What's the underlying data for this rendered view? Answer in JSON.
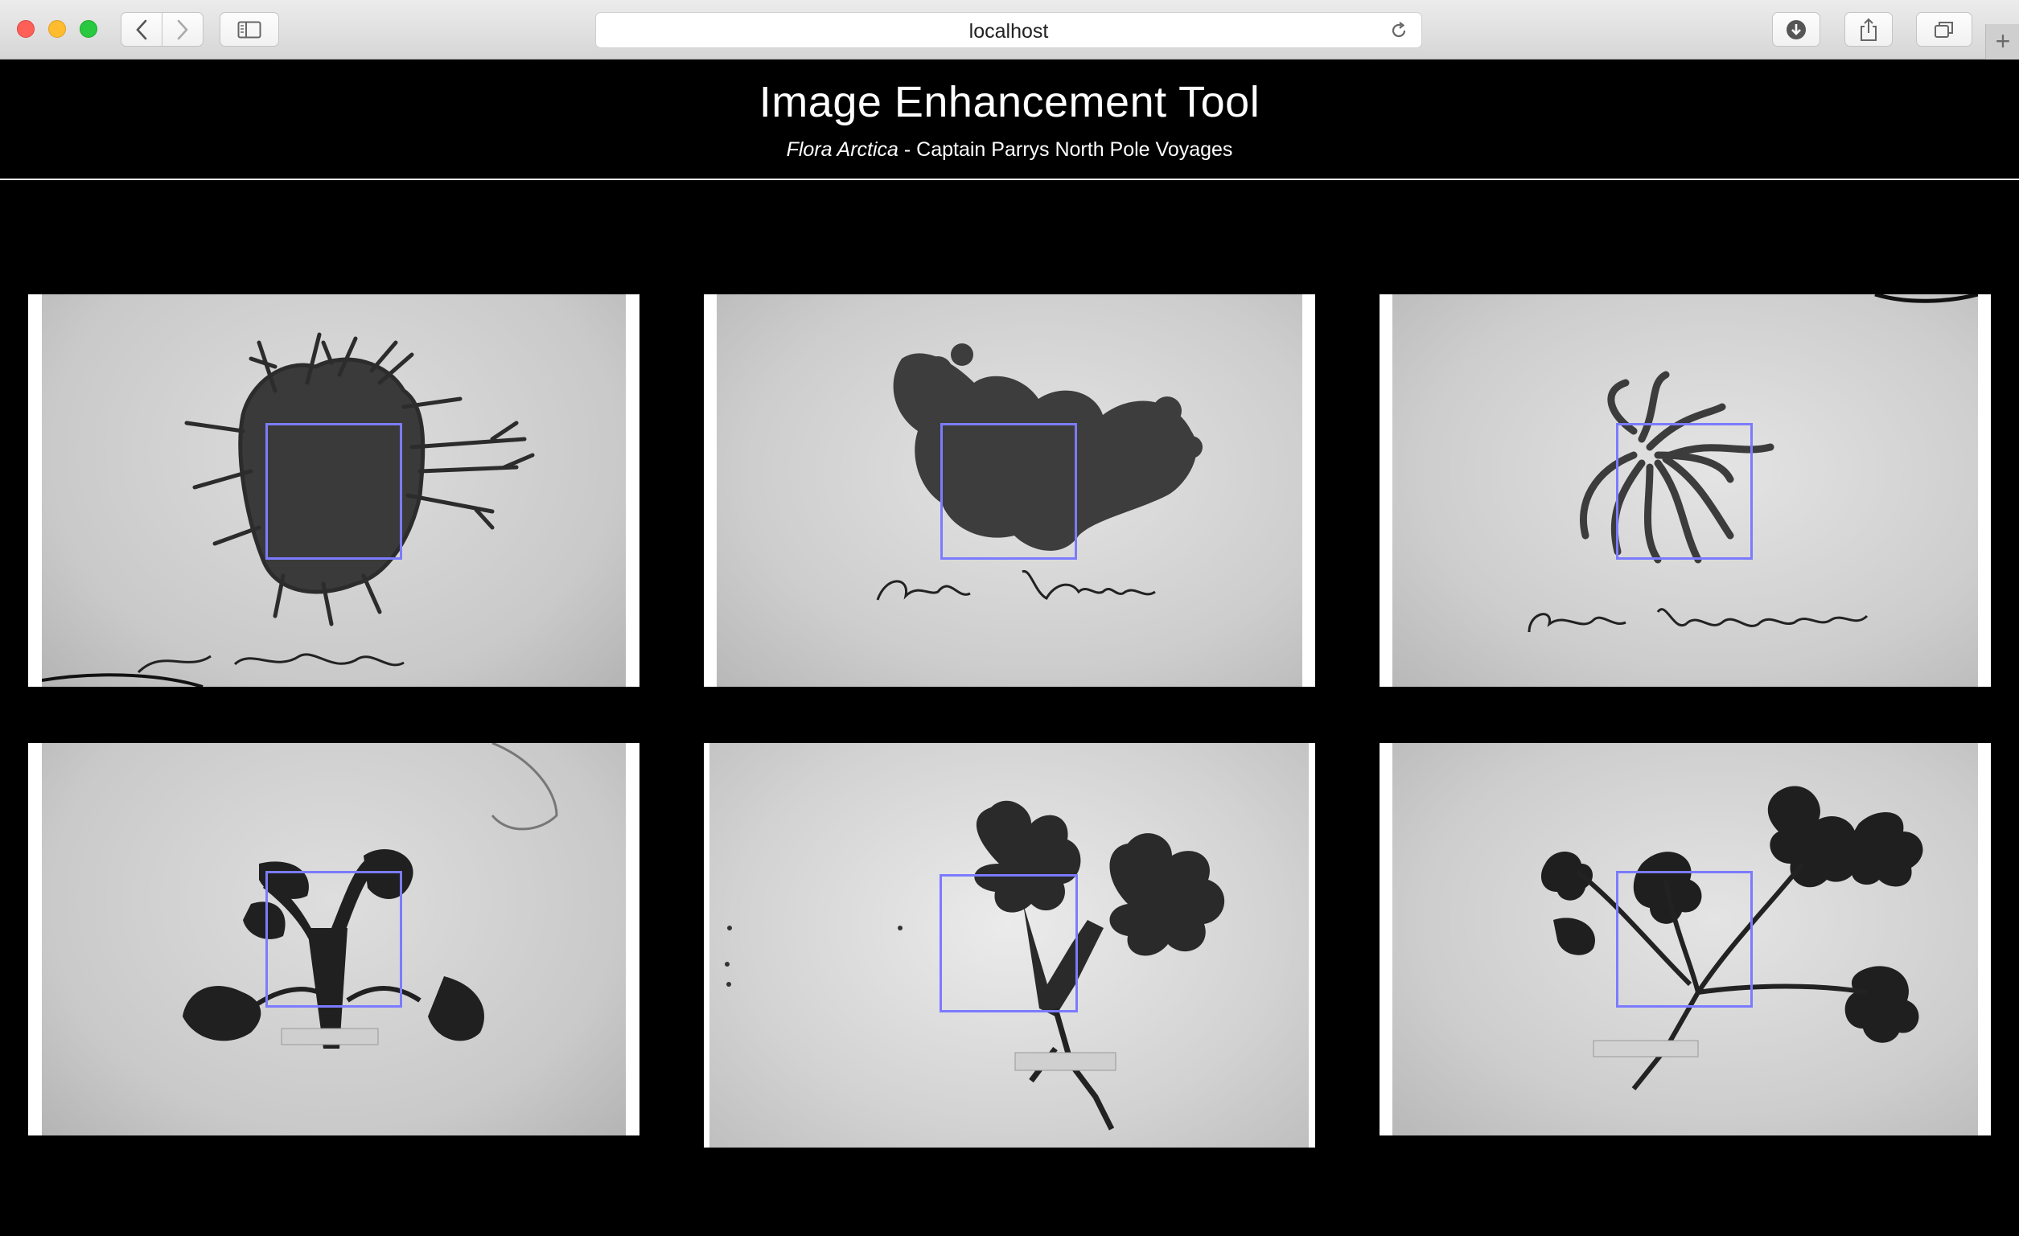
{
  "browser": {
    "address": "localhost",
    "icons": {
      "back": "chevron-left-icon",
      "forward": "chevron-right-icon",
      "sidebar": "sidebar-icon",
      "reload": "reload-icon",
      "downloads": "download-icon",
      "share": "share-icon",
      "tabs": "tabs-overview-icon",
      "new_tab": "plus-icon"
    },
    "new_tab_symbol": "+"
  },
  "header": {
    "title": "Image Enhancement Tool",
    "subtitle_italic": "Flora Arctica",
    "subtitle_rest": " - Captain Parrys North Pole Voyages"
  },
  "colors": {
    "background": "#000000",
    "selection_box": "#7b7bff"
  }
}
